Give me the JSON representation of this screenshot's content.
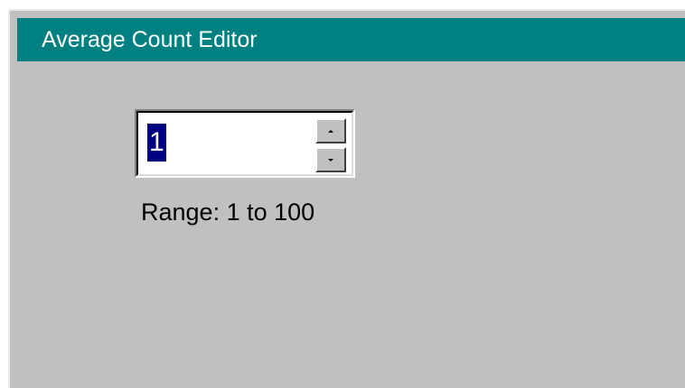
{
  "window": {
    "title": "Average Count Editor"
  },
  "editor": {
    "value": "1",
    "range_label": "Range: 1 to 100",
    "spin_up_icon": "spin-up-arrow",
    "spin_down_icon": "spin-down-arrow"
  },
  "colors": {
    "title_bar": "#008080",
    "window_bg": "#c0c0c0",
    "selection": "#000080"
  }
}
